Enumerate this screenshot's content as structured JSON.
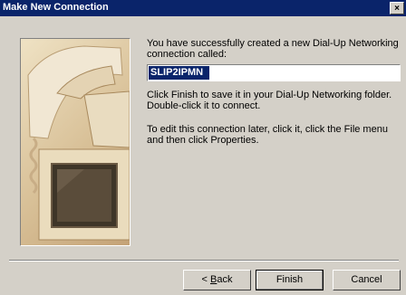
{
  "window": {
    "title": "Make New Connection",
    "close_label": "×"
  },
  "wizard": {
    "intro_text": "You have successfully created a new Dial-Up Networking connection called:",
    "connection_name": "SLIP2IPMN",
    "finish_text": "Click Finish to save it in your Dial-Up Networking folder. Double-click it to connect.",
    "edit_text": "To edit this connection later, click it, click the File menu and then click Properties."
  },
  "buttons": {
    "back_prefix": "< ",
    "back_mnemonic": "B",
    "back_rest": "ack",
    "finish": "Finish",
    "cancel": "Cancel"
  },
  "colors": {
    "titlebar": "#0a246a",
    "dialog_bg": "#d4d0c8",
    "selection": "#0a246a"
  },
  "icons": {
    "picture": "computer-and-telephone-illustration",
    "close": "close-icon"
  }
}
